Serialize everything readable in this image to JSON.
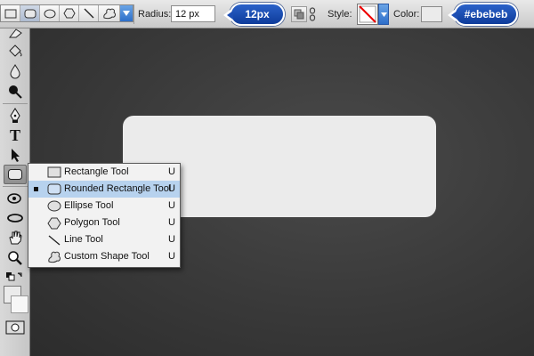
{
  "options_bar": {
    "radius_label": "Radius:",
    "radius_value": "12 px",
    "radius_callout": "12px",
    "style_label": "Style:",
    "color_label": "Color:",
    "color_callout": "#ebebeb",
    "shape_fill_color": "#ebebeb"
  },
  "flyout_menu": {
    "items": [
      {
        "label": "Rectangle Tool",
        "shortcut": "U",
        "icon": "rectangle-icon",
        "selected": false
      },
      {
        "label": "Rounded Rectangle Tool",
        "shortcut": "U",
        "icon": "rounded-rectangle-icon",
        "selected": true
      },
      {
        "label": "Ellipse Tool",
        "shortcut": "U",
        "icon": "ellipse-icon",
        "selected": false
      },
      {
        "label": "Polygon Tool",
        "shortcut": "U",
        "icon": "polygon-icon",
        "selected": false
      },
      {
        "label": "Line Tool",
        "shortcut": "U",
        "icon": "line-icon",
        "selected": false
      },
      {
        "label": "Custom Shape Tool",
        "shortcut": "U",
        "icon": "custom-shape-icon",
        "selected": false
      }
    ]
  },
  "colors": {
    "callout_blue": "#1e4fb4",
    "menu_highlight": "#b7d2ee"
  }
}
